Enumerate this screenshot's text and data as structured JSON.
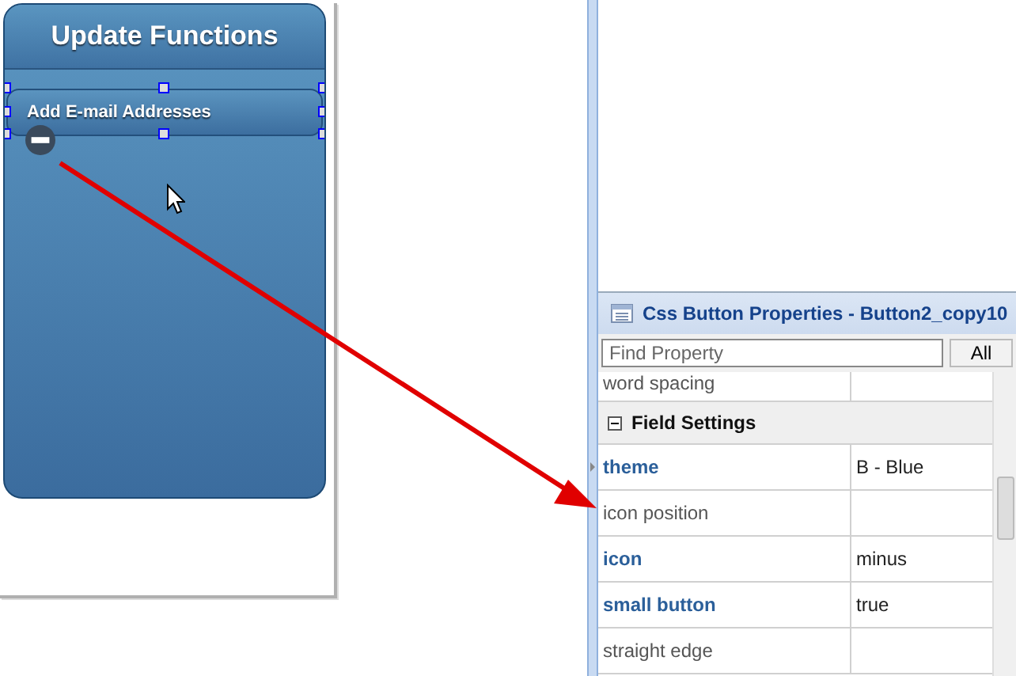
{
  "designer": {
    "page_title": "Update Functions",
    "button": {
      "label": "Add E-mail Addresses",
      "selected": true
    }
  },
  "properties_panel": {
    "title": "Css Button Properties - Button2_copy10",
    "search": {
      "placeholder": "Find Property"
    },
    "filter_button": "All",
    "rows_above": [
      {
        "name": "word spacing",
        "modified": false
      }
    ],
    "sections": [
      {
        "title": "Field Settings",
        "expanded": true,
        "rows": [
          {
            "name": "theme",
            "value": "B - Blue",
            "modified": true
          },
          {
            "name": "icon position",
            "modified": false
          },
          {
            "name": "icon",
            "value": "minus",
            "modified": true
          },
          {
            "name": "small button",
            "value": "true",
            "modified": true
          },
          {
            "name": "straight edge",
            "modified": false
          }
        ]
      }
    ]
  }
}
